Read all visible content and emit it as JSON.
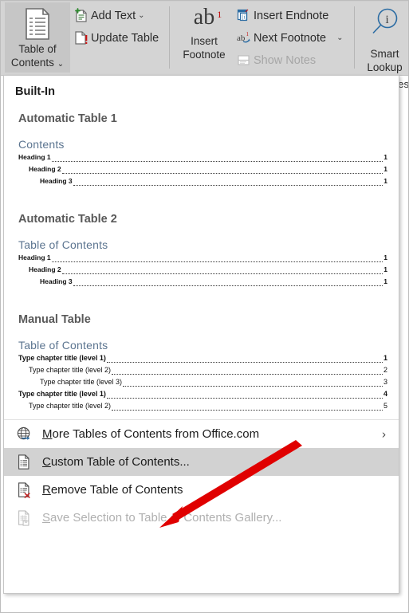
{
  "ribbon": {
    "toc_button": {
      "line1": "Table of",
      "line2": "Contents",
      "caret": "⌄",
      "icon": "table-of-contents-icon"
    },
    "add_text": {
      "label": "Add Text",
      "caret": "⌄",
      "icon": "add-text-icon"
    },
    "update_table": {
      "label": "Update Table",
      "icon": "update-table-icon"
    },
    "insert_footnote": {
      "glyph": "ab",
      "sup": "1",
      "line1": "Insert",
      "line2": "Footnote",
      "icon": "insert-footnote-icon"
    },
    "insert_endnote": {
      "label": "Insert Endnote",
      "icon": "insert-endnote-icon"
    },
    "next_footnote": {
      "label": "Next Footnote",
      "caret": "⌄",
      "icon": "next-footnote-icon"
    },
    "show_notes": {
      "label": "Show Notes",
      "icon": "show-notes-icon",
      "disabled": true
    },
    "smart_lookup": {
      "line1": "Smart",
      "line2": "Lookup",
      "glyph": "i",
      "icon": "smart-lookup-icon"
    }
  },
  "edge": {
    "partial_text": "es"
  },
  "gallery": {
    "group_heading": "Built-In",
    "entries": [
      {
        "title": "Automatic Table 1",
        "preview_heading": "Contents",
        "rows": [
          {
            "text": "Heading 1",
            "page": "1",
            "level": 1
          },
          {
            "text": "Heading 2",
            "page": "1",
            "level": 2
          },
          {
            "text": "Heading 3",
            "page": "1",
            "level": 3
          }
        ]
      },
      {
        "title": "Automatic Table 2",
        "preview_heading": "Table of Contents",
        "rows": [
          {
            "text": "Heading 1",
            "page": "1",
            "level": 1
          },
          {
            "text": "Heading 2",
            "page": "1",
            "level": 2
          },
          {
            "text": "Heading 3",
            "page": "1",
            "level": 3
          }
        ]
      },
      {
        "title": "Manual Table",
        "preview_heading": "Table of Contents",
        "rows": [
          {
            "text": "Type chapter title (level 1)",
            "page": "1",
            "level": 1
          },
          {
            "text": "Type chapter title (level 2)",
            "page": "2",
            "level": 2
          },
          {
            "text": "Type chapter title (level 3)",
            "page": "3",
            "level": 3
          },
          {
            "text": "Type chapter title (level 1)",
            "page": "4",
            "level": 1
          },
          {
            "text": "Type chapter title (level 2)",
            "page": "5",
            "level": 2
          }
        ]
      }
    ],
    "menu_items": [
      {
        "label": "More Tables of Contents from Office.com",
        "accel": "M",
        "icon": "globe-online-icon",
        "has_submenu": true,
        "submenu_glyph": "›",
        "selected": false,
        "disabled": false
      },
      {
        "label": "Custom Table of Contents...",
        "accel": "C",
        "icon": "custom-toc-document-icon",
        "has_submenu": false,
        "selected": true,
        "disabled": false
      },
      {
        "label": "Remove Table of Contents",
        "accel": "R",
        "icon": "remove-toc-document-icon",
        "has_submenu": false,
        "selected": false,
        "disabled": false
      },
      {
        "label": "Save Selection to Table of Contents Gallery...",
        "accel": "S",
        "icon": "save-selection-gallery-icon",
        "has_submenu": false,
        "selected": false,
        "disabled": true
      }
    ]
  },
  "annotation": {
    "type": "red-arrow",
    "points_to": "Custom Table of Contents...",
    "color": "#e00000"
  },
  "colors": {
    "ribbon_bg": "#d4d4d4",
    "toc_button_active": "#c6c6c6",
    "menu_selected": "#d2d2d2",
    "preview_heading": "#5c7590",
    "entry_title": "#595959",
    "arrow_red": "#e00000",
    "accent_blue": "#2b6ca3"
  }
}
